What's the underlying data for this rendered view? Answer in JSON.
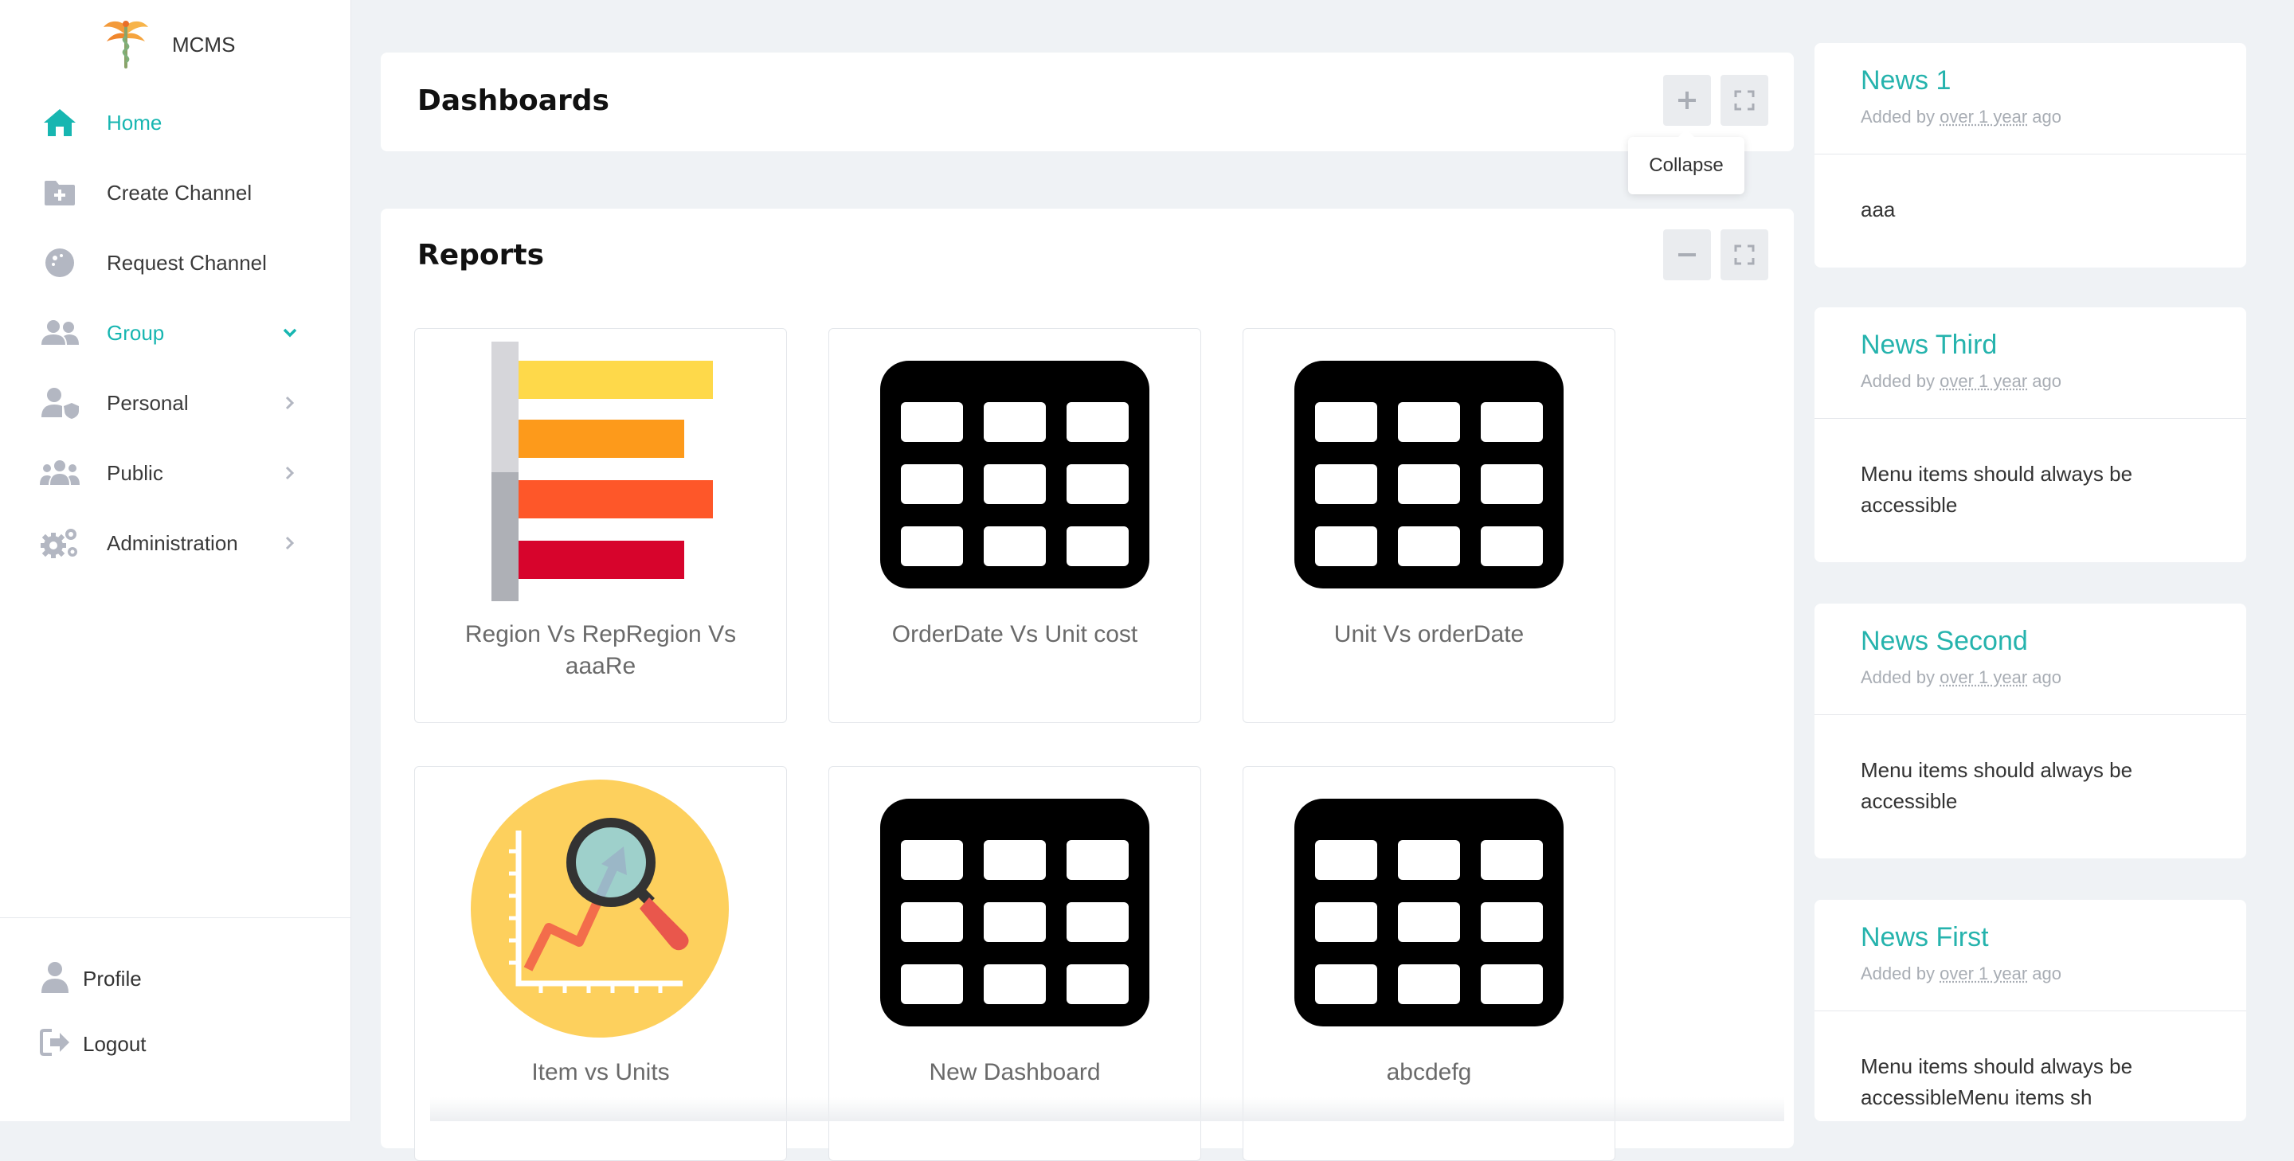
{
  "app": {
    "name": "MCMS"
  },
  "sidebar": {
    "items": [
      {
        "label": "Home",
        "icon": "home-icon",
        "active": true
      },
      {
        "label": "Create Channel",
        "icon": "folder-plus-icon",
        "active": false
      },
      {
        "label": "Request Channel",
        "icon": "meteor-ball-icon",
        "active": false
      },
      {
        "label": "Group",
        "icon": "users-icon",
        "active": true,
        "chevron": "chevron-down-icon"
      },
      {
        "label": "Personal",
        "icon": "user-shield-icon",
        "active": false,
        "chevron": "chevron-right-icon"
      },
      {
        "label": "Public",
        "icon": "users-group-icon",
        "active": false,
        "chevron": "chevron-right-icon"
      },
      {
        "label": "Administration",
        "icon": "gears-icon",
        "active": false,
        "chevron": "chevron-right-icon"
      }
    ],
    "footer": [
      {
        "label": "Profile",
        "icon": "user-icon"
      },
      {
        "label": "Logout",
        "icon": "logout-icon"
      }
    ]
  },
  "dashboards": {
    "title": "Dashboards",
    "add_icon": "plus-icon",
    "fullscreen_icon": "expand-icon",
    "tooltip": "Collapse"
  },
  "reports": {
    "title": "Reports",
    "collapse_icon": "minus-icon",
    "fullscreen_icon": "expand-icon",
    "cards": [
      {
        "label": "Region Vs RepRegion Vs aaaRe",
        "image": "bar-chart-image"
      },
      {
        "label": "OrderDate Vs Unit cost",
        "image": "table-grid-image"
      },
      {
        "label": "Unit Vs orderDate",
        "image": "table-grid-image"
      },
      {
        "label": "Item vs Units",
        "image": "analytics-magnifier-image"
      },
      {
        "label": "New Dashboard",
        "image": "table-grid-image"
      },
      {
        "label": "abcdefg",
        "image": "table-grid-image"
      }
    ]
  },
  "news": [
    {
      "title": "News 1",
      "meta_prefix": "Added by",
      "meta_time": "over 1 year",
      "meta_suffix": "ago",
      "body": "aaa"
    },
    {
      "title": "News Third",
      "meta_prefix": "Added by",
      "meta_time": "over 1 year",
      "meta_suffix": "ago",
      "body": "Menu items should always be accessible"
    },
    {
      "title": "News Second",
      "meta_prefix": "Added by",
      "meta_time": "over 1 year",
      "meta_suffix": "ago",
      "body": "Menu items should always be accessible"
    },
    {
      "title": "News First",
      "meta_prefix": "Added by",
      "meta_time": "over 1 year",
      "meta_suffix": "ago",
      "body": "Menu items should always be accessibleMenu items sh"
    }
  ],
  "colors": {
    "accent": "#17b6b1",
    "news_title": "#25b3ad",
    "icon_gray": "#b3b7c2",
    "background": "#eff2f5"
  }
}
